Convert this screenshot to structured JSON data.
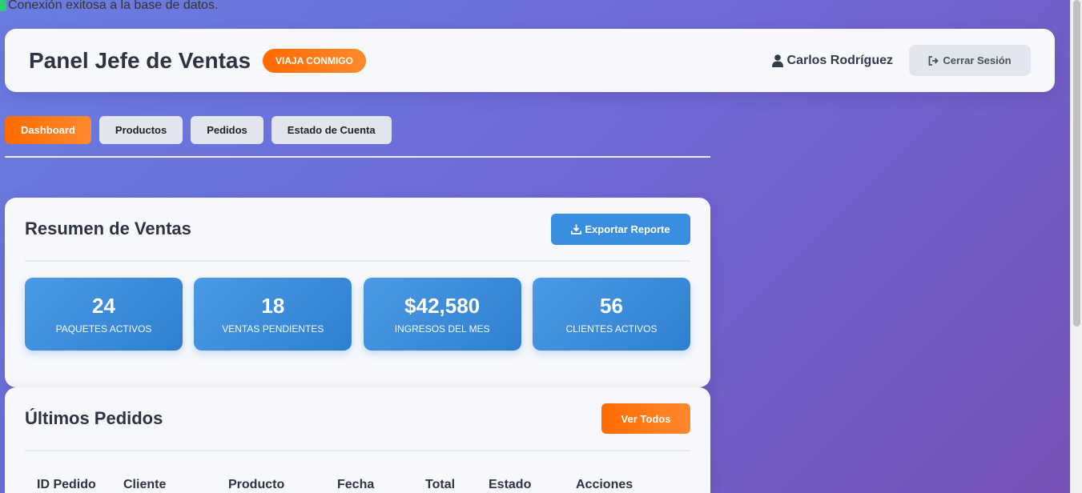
{
  "db_message": "Conexión exitosa a la base de datos.",
  "header": {
    "title": "Panel Jefe de Ventas",
    "brand": "VIAJA CONMIGO",
    "user_name": "Carlos Rodríguez",
    "logout_label": "Cerrar Sesión"
  },
  "tabs": [
    {
      "label": "Dashboard",
      "active": true
    },
    {
      "label": "Productos",
      "active": false
    },
    {
      "label": "Pedidos",
      "active": false
    },
    {
      "label": "Estado de Cuenta",
      "active": false
    }
  ],
  "summary": {
    "title": "Resumen de Ventas",
    "export_label": "Exportar Reporte",
    "stats": [
      {
        "value": "24",
        "label": "PAQUETES ACTIVOS"
      },
      {
        "value": "18",
        "label": "VENTAS PENDIENTES"
      },
      {
        "value": "$42,580",
        "label": "INGRESOS DEL MES"
      },
      {
        "value": "56",
        "label": "CLIENTES ACTIVOS"
      }
    ]
  },
  "orders": {
    "title": "Últimos Pedidos",
    "view_all_label": "Ver Todos",
    "columns": [
      "ID Pedido",
      "Cliente",
      "Producto",
      "Fecha",
      "Total",
      "Estado",
      "Acciones"
    ]
  },
  "colors": {
    "accent_orange": "#ff6a00",
    "accent_blue": "#3a8ee0",
    "success": "#2ecc71"
  }
}
